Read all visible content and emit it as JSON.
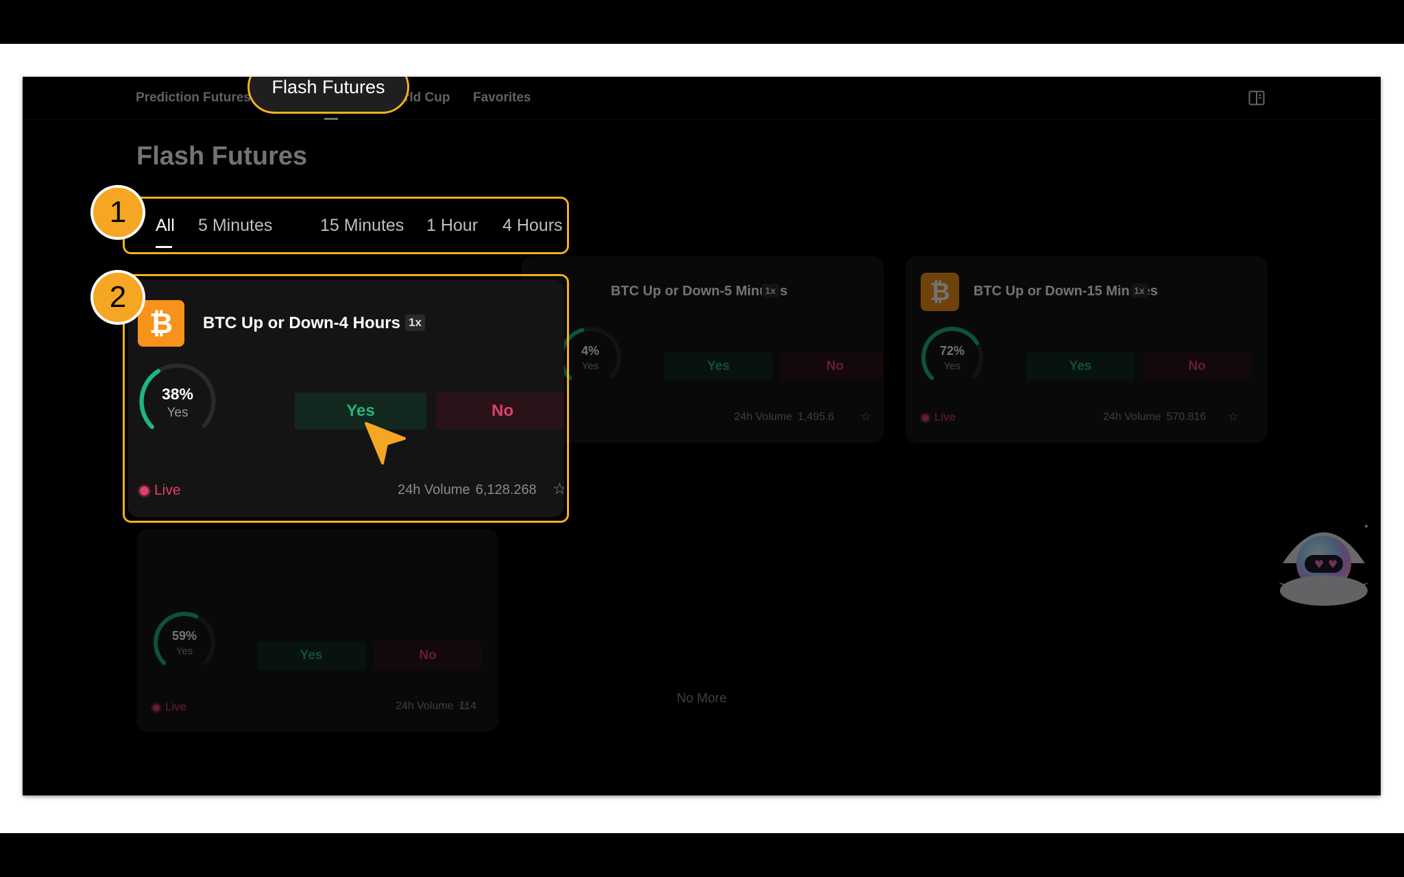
{
  "nav": {
    "items": [
      "Prediction Futures",
      "rld Cup",
      "Favorites"
    ],
    "tooltip": "Flash Futures"
  },
  "page": {
    "title": "Flash Futures"
  },
  "tabs": [
    "All",
    "5 Minutes",
    "15 Minutes",
    "1 Hour",
    "4 Hours"
  ],
  "steps": [
    "1",
    "2"
  ],
  "cards": {
    "focus": {
      "title": "BTC Up or Down-4 Hours",
      "lev": "1x",
      "pct": "38%",
      "pct_value": 0.38,
      "yes_caption": "Yes",
      "yes": "Yes",
      "no": "No",
      "live": "Live",
      "vol_label": "24h Volume",
      "vol": "6,128.268"
    },
    "five": {
      "title": "BTC Up or Down-5 Minutes",
      "lev": "1x",
      "pct": "4%",
      "pct_value": 0.44,
      "yes_caption": "Yes",
      "yes": "Yes",
      "no": "No",
      "vol_label": "24h Volume",
      "vol": "1,495.6"
    },
    "fifteen": {
      "title": "BTC Up or Down-15 Minutes",
      "lev": "1x",
      "pct": "72%",
      "pct_value": 0.72,
      "yes_caption": "Yes",
      "yes": "Yes",
      "no": "No",
      "live": "Live",
      "vol_label": "24h Volume",
      "vol": "570.816"
    },
    "hour": {
      "pct": "59%",
      "pct_value": 0.59,
      "yes_caption": "Yes",
      "yes": "Yes",
      "no": "No",
      "live": "Live",
      "vol_label": "24h Volume",
      "vol": "114"
    }
  },
  "footer": {
    "no_more": "No More"
  },
  "colors": {
    "accent": "#f5b021",
    "yes": "#25b47a",
    "no": "#e0406a",
    "btc": "#f7931a"
  }
}
